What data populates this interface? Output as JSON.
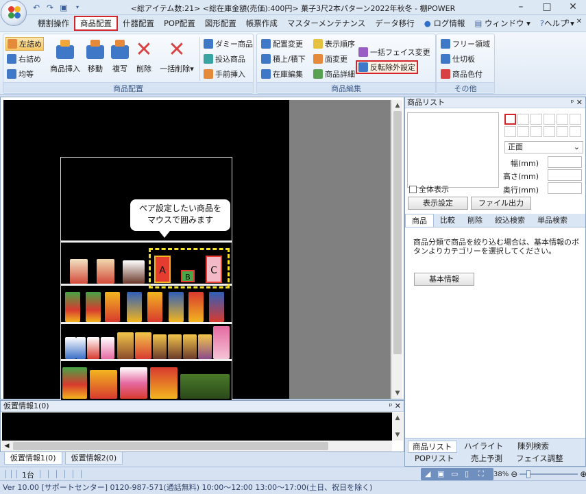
{
  "window": {
    "title": "<総アイテム数:21> <総在庫金額(売価):400円> 菓子3尺2本パターン2022年秋冬 - 棚POWER",
    "controls": [
      "–",
      "□",
      "✕"
    ]
  },
  "menu": {
    "tabs": [
      "棚割操作",
      "商品配置",
      "什器配置",
      "POP配置",
      "図形配置",
      "帳票作成",
      "マスターメンテナンス",
      "データ移行",
      "ログ情報",
      "ウィンドウ",
      "ヘルプ"
    ],
    "active": "商品配置",
    "mdi_controls": [
      "-",
      "▫",
      "✕"
    ]
  },
  "ribbon": {
    "group_placement": {
      "label": "商品配置",
      "left_align": "左詰め",
      "right_align": "右詰め",
      "equal": "均等",
      "insert": "商品挿入",
      "move": "移動",
      "copy": "複写",
      "delete": "削除",
      "bulk_delete": "一括削除",
      "dummy": "ダミー商品",
      "throw_in": "投込商品",
      "front_insert": "手前挿入"
    },
    "group_edit": {
      "label": "商品編集",
      "change_placement": "配置変更",
      "display_order": "表示順序",
      "stack": "積上/積下",
      "face_change": "面変更",
      "stock_edit": "在庫編集",
      "product_detail": "商品詳細",
      "bulk_face_change": "一括フェイス変更",
      "reverse_exclude": "反転除外設定"
    },
    "group_other": {
      "label": "その他",
      "free_area": "フリー領域",
      "partition": "仕切板",
      "product_color": "商品色付"
    }
  },
  "canvas": {
    "callout": [
      "ペア設定したい商品を",
      "マウスで囲みます"
    ],
    "tags": {
      "a": "A",
      "b": "B",
      "c": "C"
    },
    "tag_colors": {
      "a": "#e43d2f",
      "b": "#4aa84a",
      "c": "#f3b9c6"
    },
    "selection_color": "#f5e02a"
  },
  "kari": {
    "title": "仮置情報1(0)",
    "tabs": [
      "仮置情報1(0)",
      "仮置情報2(0)"
    ]
  },
  "right_panel": {
    "title": "商品リスト",
    "face_select": "正面",
    "width_label": "幅(mm)",
    "height_label": "高さ(mm)",
    "depth_label": "奥行(mm)",
    "show_all": "全体表示",
    "display_settings_btn": "表示設定",
    "file_output_btn": "ファイル出力",
    "tabs": [
      "商品",
      "比較",
      "削除",
      "絞込検索",
      "単品検索"
    ],
    "info_text": "商品分類で商品を絞り込む場合は、基本情報のボタンよりカテゴリーを選択してください。",
    "basic_info_btn": "基本情報",
    "bottom_tabs_row1": [
      "商品リスト",
      "ハイライト",
      "陳列検索"
    ],
    "bottom_tabs_row2": [
      "POPリスト",
      "売上予測",
      "フェイス調整"
    ]
  },
  "status": {
    "units": "1台",
    "zoom": "38%",
    "footer": "Ver 10.00 [サポートセンター] 0120-987-571(通話無料) 10:00～12:00 13:00～17:00(土日、祝日を除く)"
  }
}
